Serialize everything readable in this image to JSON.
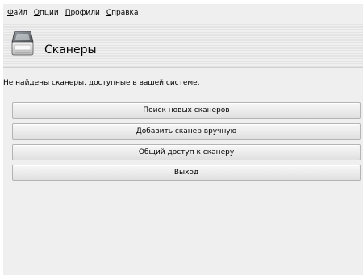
{
  "menubar": {
    "items": [
      {
        "mnemonic": "Ф",
        "rest": "айл"
      },
      {
        "mnemonic": "О",
        "rest": "пции"
      },
      {
        "mnemonic": "П",
        "rest": "рофили"
      },
      {
        "mnemonic": "С",
        "rest": "правка"
      }
    ]
  },
  "header": {
    "icon": "scanner-icon",
    "title": "Сканеры"
  },
  "main": {
    "status": "Не найдены сканеры, доступные в вашей системе.",
    "buttons": [
      {
        "label": "Поиск новых сканеров"
      },
      {
        "label": "Добавить сканер вручную"
      },
      {
        "label": "Общий доступ к сканеру"
      },
      {
        "label": "Выход"
      }
    ]
  }
}
